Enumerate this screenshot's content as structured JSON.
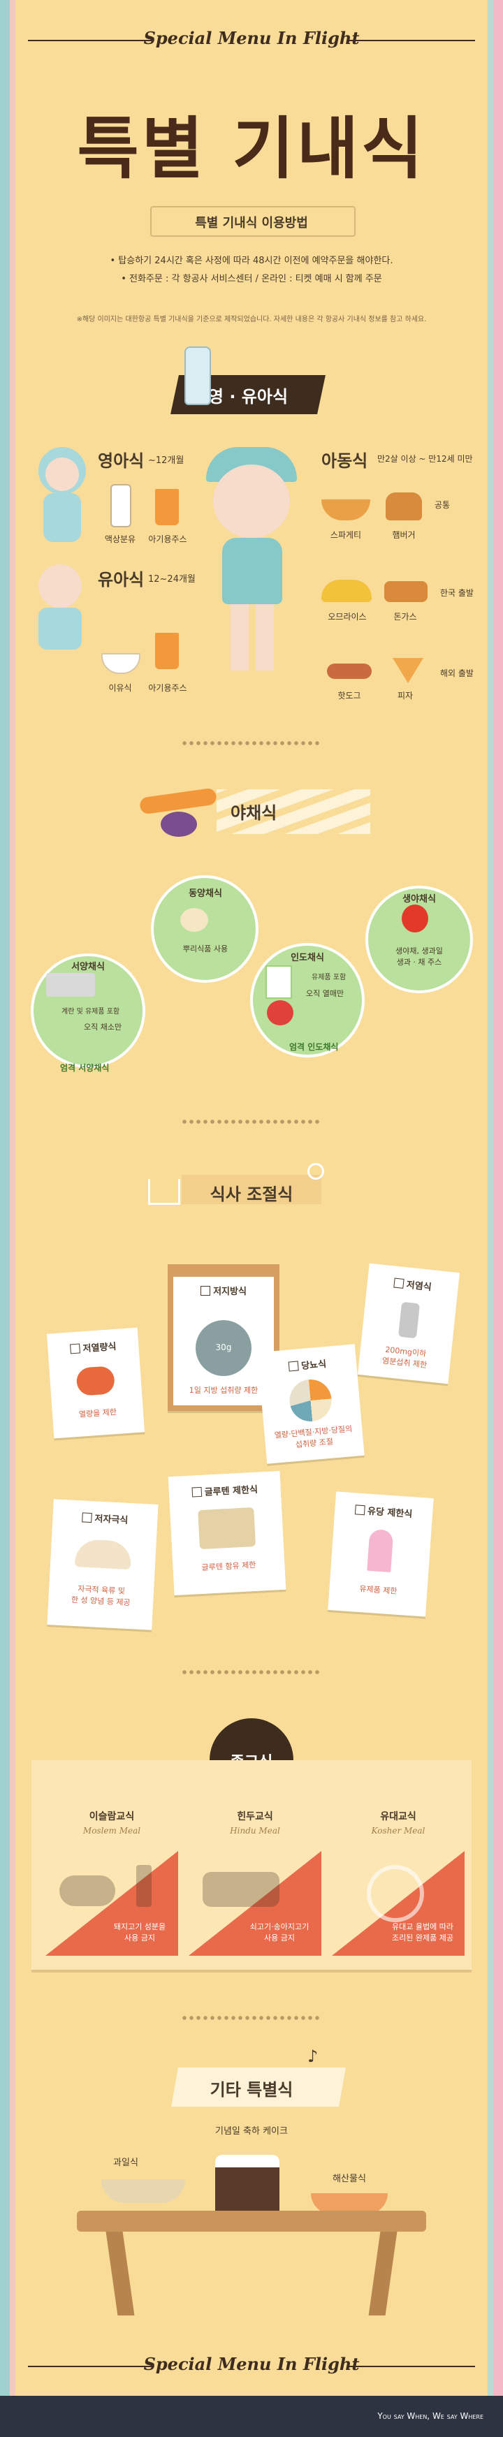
{
  "header": {
    "script_title": "Special Menu In Flight"
  },
  "title": "특별 기내식",
  "usage": {
    "heading": "특별 기내식 이용방법",
    "line1": "• 탑승하기 24시간 혹은 사정에 따라 48시간 이전에 예약주문을 해야한다.",
    "line2": "• 전화주문 : 각 항공사 서비스센터 / 온라인 : 티켓 예매 시 함께 주문",
    "note": "※해당 이미지는 대한항공 특별 기내식을 기준으로 제작되었습니다. 자세한 내용은 각 항공사 기내식 정보를 참고 하세요."
  },
  "baby": {
    "banner": "영 · 유아식",
    "infant": {
      "title": "영아식",
      "age": "~12개월",
      "items": [
        "액상분유",
        "아기용주스"
      ]
    },
    "toddler": {
      "title": "유아식",
      "age": "12~24개월",
      "items": [
        "이유식",
        "아기용주스"
      ]
    },
    "child": {
      "title": "아동식",
      "age": "만2살 이상 ~ 만12세 미만",
      "rows": [
        {
          "items": [
            "스파게티",
            "햄버거"
          ],
          "tag": "공통"
        },
        {
          "items": [
            "오므라이스",
            "돈가스"
          ],
          "tag": "한국 출발"
        },
        {
          "items": [
            "핫도그",
            "피자"
          ],
          "tag": "해외 출발"
        }
      ]
    }
  },
  "veg": {
    "banner": "야채식",
    "circles": [
      {
        "title": "동양채식",
        "desc": "뿌리식품 사용"
      },
      {
        "title": "생야채식",
        "desc": "생야채, 생과일\n생과 · 채 주스"
      },
      {
        "title": "서양채식",
        "desc": "계란 및 유제품 포함",
        "desc2": "오직 채소만",
        "tag": "엄격 서양채식"
      },
      {
        "title": "인도채식",
        "desc": "유제품 포함",
        "desc2": "오직 열매만",
        "tag": "엄격 인도채식"
      }
    ]
  },
  "diet": {
    "banner": "식사 조절식",
    "cards": [
      {
        "title": "저지방식",
        "desc": "1일 지방 섭취량 제한",
        "scale": "30g"
      },
      {
        "title": "저염식",
        "desc": "200mg이하\n염분섭취 제한"
      },
      {
        "title": "저열량식",
        "desc": "열량을 제한"
      },
      {
        "title": "당뇨식",
        "desc": "열량·단백질·지방·당질의\n섭취량 조절"
      },
      {
        "title": "글루텐 제한식",
        "desc": "글루텐 함유 제한"
      },
      {
        "title": "저자극식",
        "desc": "자극적 육류 및\n한 성 양념 등 제공"
      },
      {
        "title": "유당 제한식",
        "desc": "유제품 제한"
      }
    ]
  },
  "religion": {
    "banner": "종교식",
    "columns": [
      {
        "title": "이슬람교식",
        "script": "Moslem Meal",
        "desc": "돼지고기 성분을\n사용 금지"
      },
      {
        "title": "힌두교식",
        "script": "Hindu Meal",
        "desc": "쇠고기·송아지고기\n사용 금지"
      },
      {
        "title": "유대교식",
        "script": "Kosher Meal",
        "desc": "유대교 율법에 따라\n조리된 완제품 제공"
      }
    ]
  },
  "other": {
    "banner": "기타 특별식",
    "items": [
      "기념일 축하 케이크",
      "과일식",
      "해산물식"
    ]
  },
  "footer": {
    "script_title": "Special Menu In Flight",
    "tagline": "You say When, We say Where"
  },
  "colors": {
    "background": "#f8dc98",
    "brown": "#3e2c1e",
    "accent": "#e0654a",
    "green": "#9bd27a"
  }
}
